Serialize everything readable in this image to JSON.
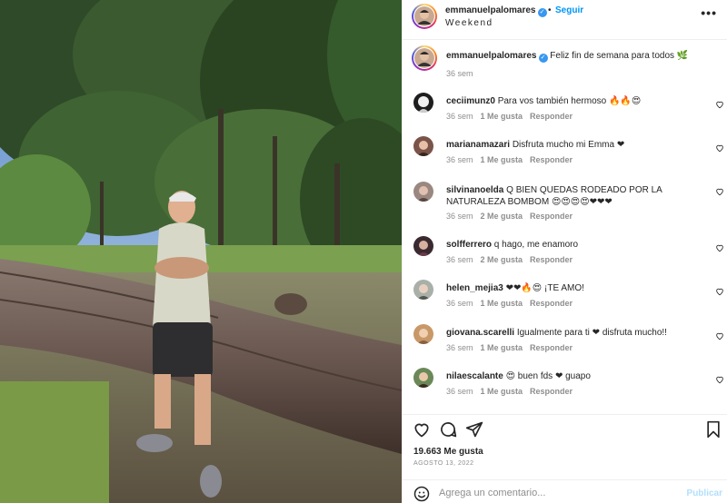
{
  "post": {
    "username": "emmanuelpalomares",
    "follow_label": "Seguir",
    "dot": "•",
    "location": "Weekend",
    "more": "•••",
    "caption": "Feliz fin de semana para todos 🌿",
    "caption_time": "36 sem"
  },
  "comments": [
    {
      "user": "ceciimunz0",
      "text": "Para vos también hermoso 🔥🔥😍",
      "time": "36 sem",
      "likes": "1 Me gusta",
      "reply": "Responder"
    },
    {
      "user": "marianamazari",
      "text": "Disfruta mucho mi Emma ❤",
      "time": "36 sem",
      "likes": "1 Me gusta",
      "reply": "Responder"
    },
    {
      "user": "silvinanoelda",
      "text": "Q BIEN QUEDAS RODEADO POR LA NATURALEZA BOMBOM 😍😍😍😍❤❤❤",
      "time": "36 sem",
      "likes": "2 Me gusta",
      "reply": "Responder"
    },
    {
      "user": "solfferrero",
      "text": "q hago, me enamoro",
      "time": "36 sem",
      "likes": "2 Me gusta",
      "reply": "Responder"
    },
    {
      "user": "helen_mejia3",
      "text": "❤❤🔥😍 ¡TE AMO!",
      "time": "36 sem",
      "likes": "1 Me gusta",
      "reply": "Responder"
    },
    {
      "user": "giovana.scarelli",
      "text": "Igualmente para ti ❤ disfruta mucho!!",
      "time": "36 sem",
      "likes": "1 Me gusta",
      "reply": "Responder"
    },
    {
      "user": "nilaescalante",
      "text": "😍 buen fds ❤ guapo",
      "time": "36 sem",
      "likes": "1 Me gusta",
      "reply": "Responder"
    }
  ],
  "stats": {
    "likes": "19.663 Me gusta",
    "date": "AGOSTO 13, 2022"
  },
  "add_comment": {
    "placeholder": "Agrega un comentario...",
    "publish": "Publicar"
  },
  "icons": [
    "heart-icon",
    "comment-icon",
    "share-icon",
    "bookmark-icon",
    "emoji-icon",
    "more-icon",
    "verified-icon"
  ],
  "colors": {
    "accent": "#0095f6",
    "verified": "#3897f0",
    "heart": "#ed4956",
    "muted": "#8e8e8e"
  }
}
